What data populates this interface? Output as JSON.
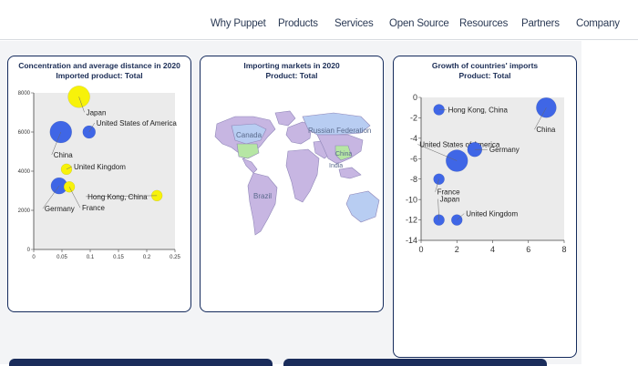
{
  "nav": {
    "items": [
      "Why Puppet",
      "Products",
      "Services",
      "Open Source",
      "Resources",
      "Partners",
      "Company"
    ]
  },
  "colors": {
    "blue_bubble": "#3f66e6",
    "yellow_bubble": "#f7f20a",
    "card_border": "#142a5c",
    "map_purple": "#c7b6e2",
    "map_green": "#b6e6a4",
    "map_blue": "#b8cdf2"
  },
  "card1": {
    "title_line1": "Concentration and average distance in 2020",
    "title_line2": "Imported product: Total"
  },
  "card2": {
    "title_line1": "Importing markets in 2020",
    "title_line2": "Product: Total",
    "labels": {
      "canada": "Canada",
      "russia": "Russian Federation",
      "china": "China",
      "india": "India",
      "brazil": "Brazil"
    }
  },
  "card3": {
    "title_line1": "Growth of countries' imports",
    "title_line2": "Product: Total"
  },
  "chart_data": [
    {
      "type": "scatter",
      "title": "Concentration and average distance in 2020",
      "subtitle": "Imported product: Total",
      "xlim": [
        0,
        0.25
      ],
      "ylim": [
        0,
        8000
      ],
      "xticks": [
        "0",
        "0.05",
        "0.1",
        "0.15",
        "0.2",
        "0.25"
      ],
      "yticks": [
        "0",
        "2000",
        "4000",
        "6000",
        "8000"
      ],
      "grid": false,
      "points": [
        {
          "label": "Japan",
          "x": 0.08,
          "y": 7800,
          "color": "#f7f20a",
          "r": 12
        },
        {
          "label": "United States of America",
          "x": 0.098,
          "y": 6000,
          "color": "#3f66e6",
          "r": 7
        },
        {
          "label": "China",
          "x": 0.048,
          "y": 6000,
          "color": "#3f66e6",
          "r": 12
        },
        {
          "label": "United Kingdom",
          "x": 0.058,
          "y": 4100,
          "color": "#f7f20a",
          "r": 6
        },
        {
          "label": "Germany",
          "x": 0.045,
          "y": 3250,
          "color": "#3f66e6",
          "r": 9
        },
        {
          "label": "France",
          "x": 0.063,
          "y": 3200,
          "color": "#f7f20a",
          "r": 6
        },
        {
          "label": "Hong Kong, China",
          "x": 0.218,
          "y": 2750,
          "color": "#f7f20a",
          "r": 6
        }
      ]
    },
    {
      "type": "scatter",
      "title": "Growth of countries' imports",
      "subtitle": "Product: Total",
      "xlim": [
        0,
        8
      ],
      "ylim": [
        -14,
        0
      ],
      "xticks": [
        "0",
        "2",
        "4",
        "6",
        "8"
      ],
      "yticks": [
        "0",
        "-2",
        "-4",
        "-6",
        "-8",
        "-10",
        "-12",
        "-14"
      ],
      "grid": false,
      "points": [
        {
          "label": "Hong Kong, China",
          "x": 1.0,
          "y": -1.2,
          "color": "#3f66e6",
          "r": 6
        },
        {
          "label": "China",
          "x": 7.0,
          "y": -1.0,
          "color": "#3f66e6",
          "r": 11
        },
        {
          "label": "United States of America",
          "x": 2.0,
          "y": -6.2,
          "color": "#3f66e6",
          "r": 12
        },
        {
          "label": "Germany",
          "x": 3.0,
          "y": -5.1,
          "color": "#3f66e6",
          "r": 8
        },
        {
          "label": "France",
          "x": 1.0,
          "y": -8.0,
          "color": "#3f66e6",
          "r": 6
        },
        {
          "label": "Japan",
          "x": 1.0,
          "y": -12.0,
          "color": "#3f66e6",
          "r": 6
        },
        {
          "label": "United Kingdom",
          "x": 2.0,
          "y": -12.0,
          "color": "#3f66e6",
          "r": 6
        }
      ]
    }
  ]
}
